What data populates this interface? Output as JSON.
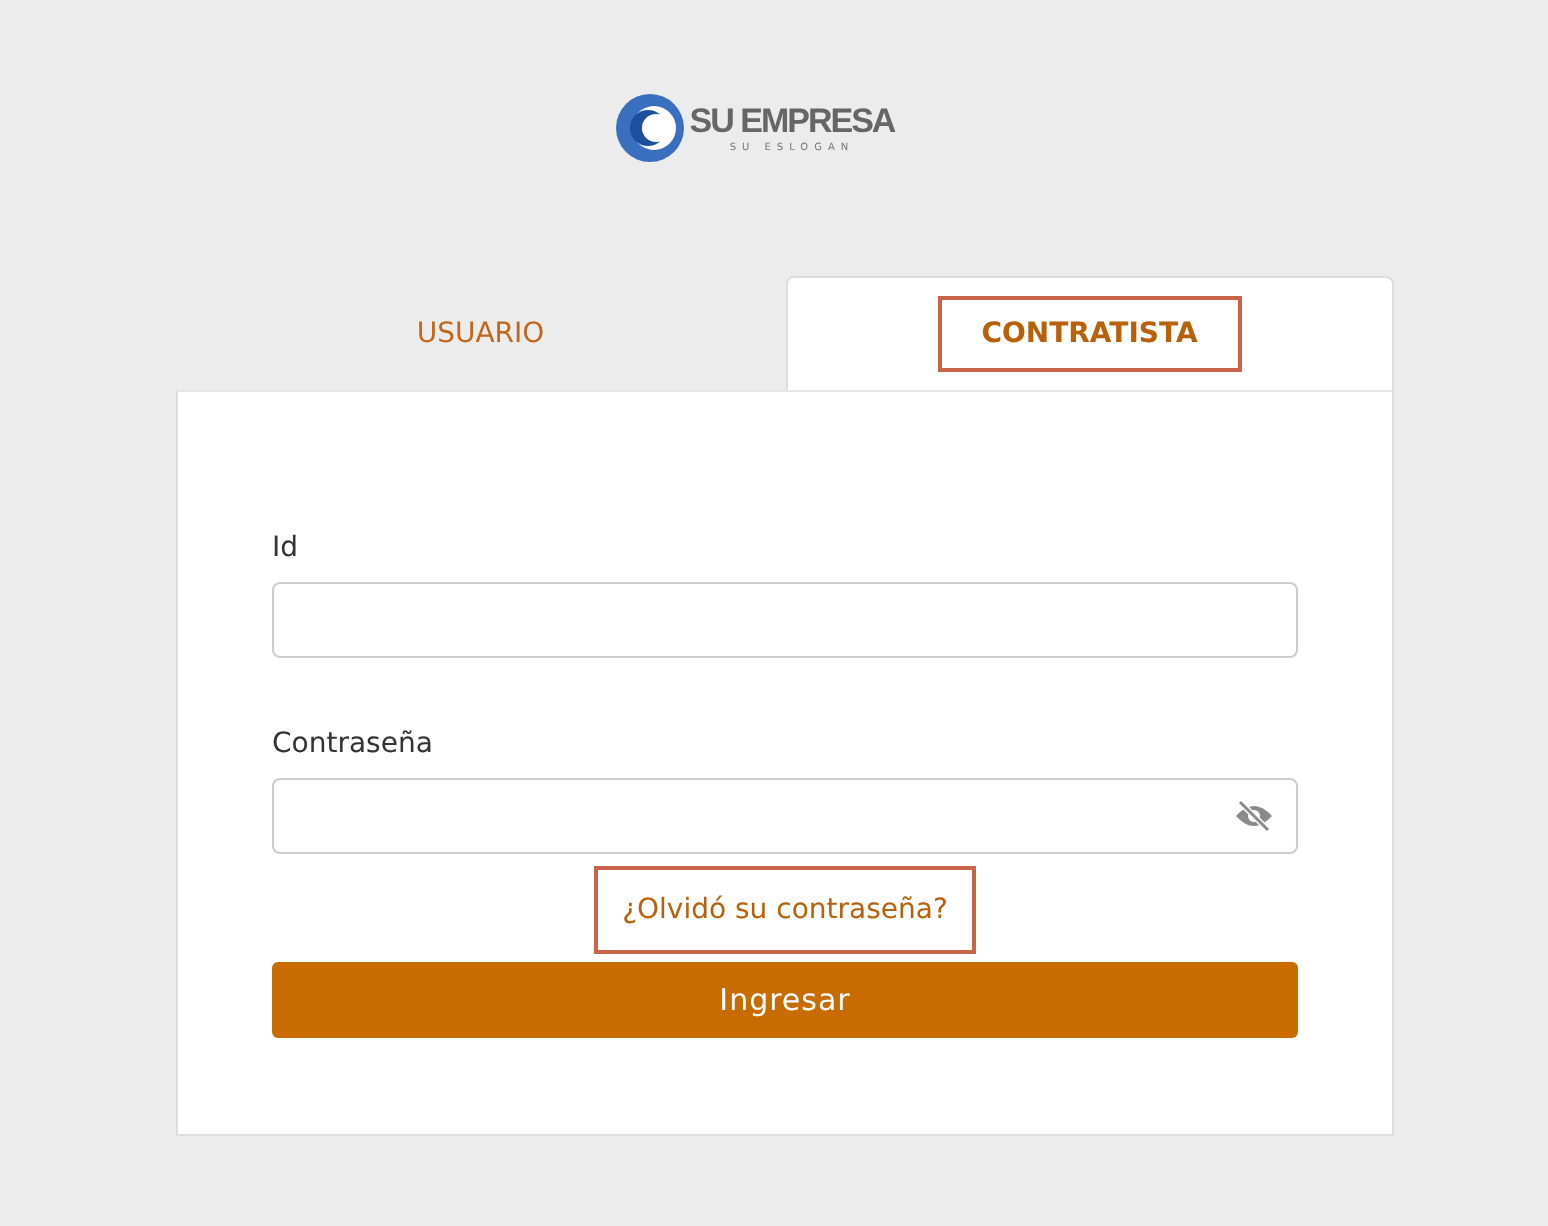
{
  "logo": {
    "name": "SU EMPRESA",
    "slogan": "SU ESLOGAN"
  },
  "tabs": [
    {
      "label": "USUARIO",
      "selected": false,
      "outlined": false
    },
    {
      "label": "CONTRATISTA",
      "selected": true,
      "outlined": true
    }
  ],
  "fields": [
    {
      "label": "Id",
      "kind": "text"
    },
    {
      "label": "Contraseña",
      "kind": "password"
    }
  ],
  "forgot_link": {
    "label": "¿Olvidó su contraseña?",
    "outlined": true
  },
  "submit_button": "Ingresar"
}
